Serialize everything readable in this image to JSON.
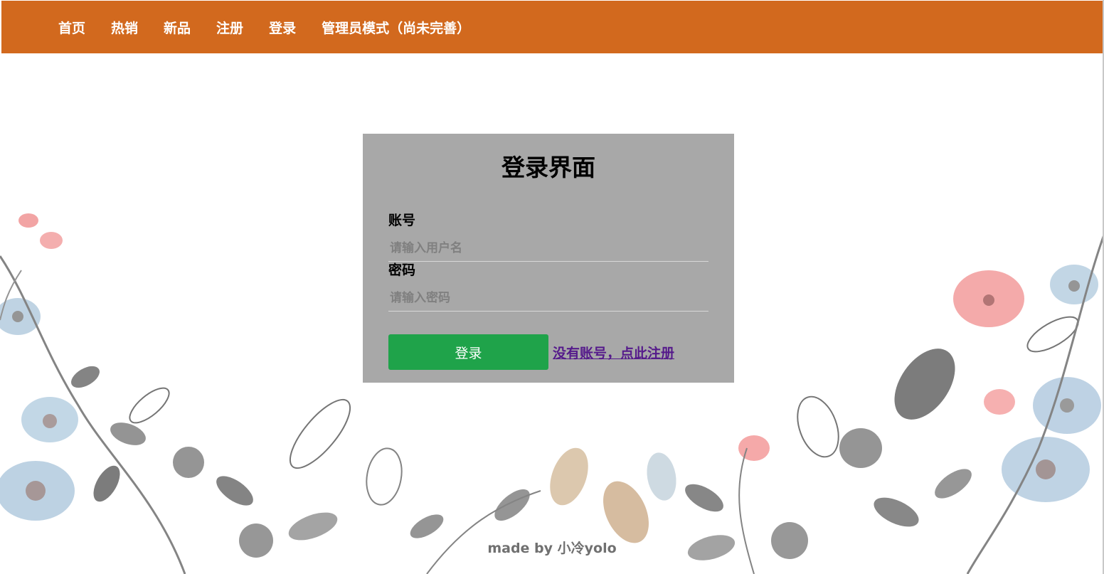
{
  "nav": {
    "background": "#d2691e",
    "items": [
      {
        "label": "首页"
      },
      {
        "label": "热销"
      },
      {
        "label": "新品"
      },
      {
        "label": "注册"
      },
      {
        "label": "登录"
      },
      {
        "label": "管理员模式（尚未完善）"
      }
    ]
  },
  "login": {
    "panel_color": "#a8a8a8",
    "title": "登录界面",
    "account_label": "账号",
    "account_placeholder": "请输入用户名",
    "password_label": "密码",
    "password_placeholder": "请输入密码",
    "submit_label": "登录",
    "submit_color": "#1fa34a",
    "register_link": "没有账号，点此注册",
    "link_color": "#551a8b"
  },
  "footer": {
    "credit": "made by 小冷yolo"
  },
  "background": {
    "decoration": "watercolor flowers and leaves illustration"
  }
}
